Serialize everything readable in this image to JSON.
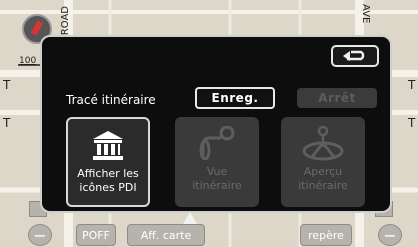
{
  "map": {
    "scale_label": "100",
    "road_label_left": "ROAD",
    "road_label_right": "AVE",
    "edge_marks": [
      "T",
      "T",
      "T",
      "T"
    ]
  },
  "bottom_bar": {
    "zoom_out": "−",
    "poi_off": "POFF",
    "map_display": "Aff. carte",
    "marker": "repère",
    "zoom_in": "−"
  },
  "dialog": {
    "route_trace_label": "Tracé itinéraire",
    "save_label": "Enreg.",
    "stop_label": "Arrêt",
    "tiles": [
      {
        "label_line1": "Afficher les",
        "label_line2": "icônes PDI",
        "icon": "building-icon",
        "enabled": true
      },
      {
        "label_line1": "Vue",
        "label_line2": "itinéraire",
        "icon": "route-view-icon",
        "enabled": false
      },
      {
        "label_line1": "Aperçu",
        "label_line2": "itinéraire",
        "icon": "route-overview-icon",
        "enabled": false
      }
    ],
    "back_icon": "return-arrow-icon"
  },
  "colors": {
    "dialog_bg": "#0d0d0d",
    "disabled_text": "#6a6a6a",
    "map_bg": "#dcd7c8"
  }
}
